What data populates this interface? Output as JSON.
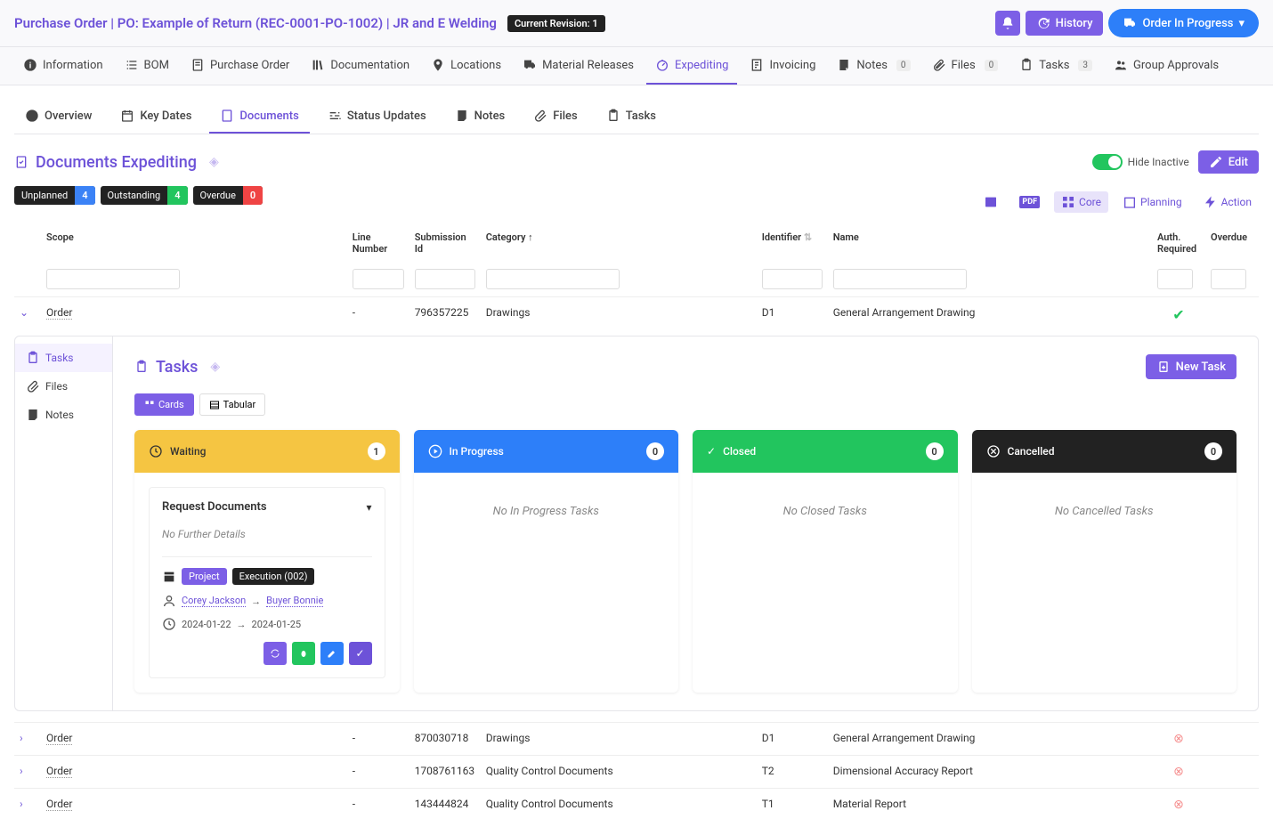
{
  "header": {
    "title": "Purchase Order | PO: Example of Return (REC-0001-PO-1002) | JR and E Welding",
    "revision": "Current Revision: 1",
    "history": "History",
    "status_btn": "Order In Progress"
  },
  "mainnav": {
    "info": "Information",
    "bom": "BOM",
    "po": "Purchase Order",
    "doc": "Documentation",
    "loc": "Locations",
    "mr": "Material Releases",
    "exp": "Expediting",
    "inv": "Invoicing",
    "notes": "Notes",
    "notes_count": "0",
    "files": "Files",
    "files_count": "0",
    "tasks": "Tasks",
    "tasks_count": "3",
    "ga": "Group Approvals"
  },
  "subtabs": {
    "overview": "Overview",
    "keydates": "Key Dates",
    "documents": "Documents",
    "status": "Status Updates",
    "notes": "Notes",
    "files": "Files",
    "tasks": "Tasks"
  },
  "section": {
    "title": "Documents Expediting",
    "hide_inactive": "Hide Inactive",
    "edit": "Edit"
  },
  "pills": {
    "unplanned": "Unplanned",
    "unplanned_n": "4",
    "outstanding": "Outstanding",
    "outstanding_n": "4",
    "overdue": "Overdue",
    "overdue_n": "0"
  },
  "tools": {
    "core": "Core",
    "planning": "Planning",
    "action": "Action"
  },
  "cols": {
    "scope": "Scope",
    "lineno": "Line Number",
    "subid": "Submission Id",
    "category": "Category",
    "identifier": "Identifier",
    "name": "Name",
    "auth": "Auth. Required",
    "overdue": "Overdue"
  },
  "rows": [
    {
      "scope": "Order",
      "lineno": "-",
      "subid": "796357225",
      "category": "Drawings",
      "identifier": "D1",
      "name": "General Arrangement Drawing",
      "auth": "check"
    },
    {
      "scope": "Order",
      "lineno": "-",
      "subid": "870030718",
      "category": "Drawings",
      "identifier": "D1",
      "name": "General Arrangement Drawing",
      "auth": "x"
    },
    {
      "scope": "Order",
      "lineno": "-",
      "subid": "1708761163",
      "category": "Quality Control Documents",
      "identifier": "T2",
      "name": "Dimensional Accuracy Report",
      "auth": "x"
    },
    {
      "scope": "Order",
      "lineno": "-",
      "subid": "143444824",
      "category": "Quality Control Documents",
      "identifier": "T1",
      "name": "Material Report",
      "auth": "x"
    }
  ],
  "detail": {
    "tasks": "Tasks",
    "files": "Files",
    "notes": "Notes"
  },
  "tasks": {
    "title": "Tasks",
    "new": "New Task",
    "cards": "Cards",
    "tabular": "Tabular",
    "cols": {
      "waiting": "Waiting",
      "waiting_n": "1",
      "progress": "In Progress",
      "progress_n": "0",
      "closed": "Closed",
      "closed_n": "0",
      "cancelled": "Cancelled",
      "cancelled_n": "0"
    },
    "empty": {
      "progress": "No In Progress Tasks",
      "closed": "No Closed Tasks",
      "cancelled": "No Cancelled Tasks"
    },
    "card": {
      "title": "Request Documents",
      "details": "No Further Details",
      "tag1": "Project",
      "tag2": "Execution (002)",
      "from": "Corey Jackson",
      "to": "Buyer Bonnie",
      "d1": "2024-01-22",
      "d2": "2024-01-25"
    }
  }
}
